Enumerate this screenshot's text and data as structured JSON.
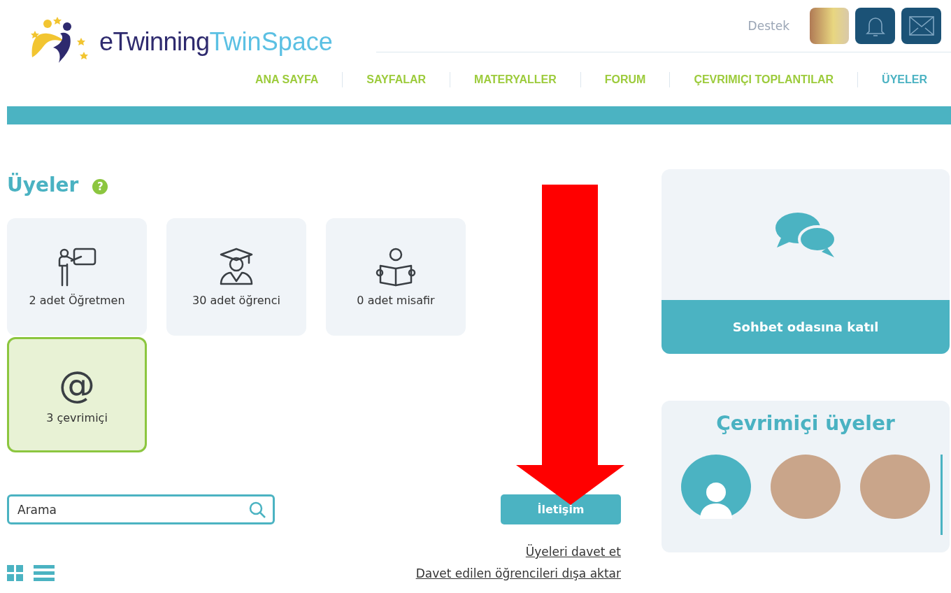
{
  "header": {
    "logo": {
      "part_1": "eTwinning",
      "part_2": "TwinSpace"
    },
    "support_link": "Destek"
  },
  "nav": [
    {
      "label": "ANA SAYFA",
      "selected": false
    },
    {
      "label": "SAYFALAR",
      "selected": false
    },
    {
      "label": "MATERYALLER",
      "selected": false
    },
    {
      "label": "FORUM",
      "selected": false
    },
    {
      "label": "ÇEVRIMIÇI TOPLANTILAR",
      "selected": false
    },
    {
      "label": "ÜYELER",
      "selected": true
    }
  ],
  "page_title": "Üyeler",
  "help_badge": "?",
  "stats": [
    {
      "kind": "teacher",
      "label": "2 adet Öğretmen",
      "selected": false
    },
    {
      "kind": "student",
      "label": "30 adet öğrenci",
      "selected": false
    },
    {
      "kind": "guest",
      "label": "0 adet misafir",
      "selected": false
    },
    {
      "kind": "online",
      "symbol": "@",
      "label": "3 çevrimiçi",
      "selected": true
    }
  ],
  "search": {
    "placeholder": "Arama"
  },
  "contact_button": "İletişim",
  "links": [
    "Üyeleri davet et",
    "Davet edilen öğrencileri dışa aktar"
  ],
  "chat": {
    "button": "Sohbet odasına katıl"
  },
  "online_members": {
    "title": "Çevrimiçi üyeler",
    "avatars": [
      {
        "kind": "default"
      },
      {
        "kind": "photo"
      },
      {
        "kind": "photo"
      }
    ]
  }
}
